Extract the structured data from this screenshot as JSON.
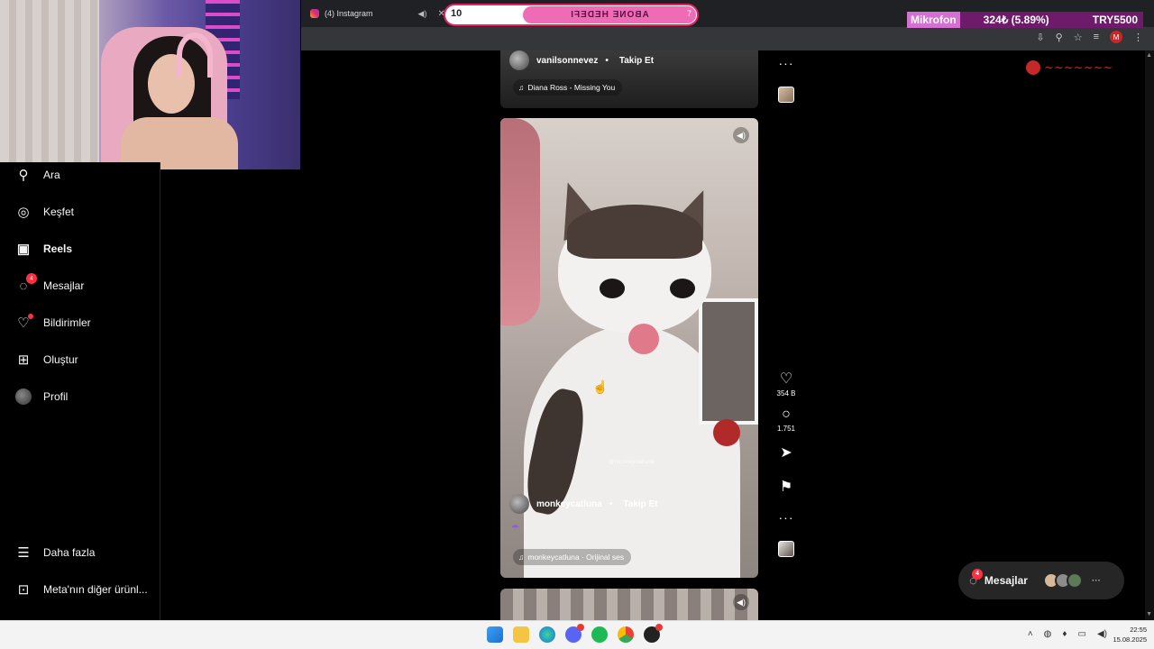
{
  "browser": {
    "tab_title": "(4) Instagram",
    "overlay_counter": "10",
    "overlay_banner": "ABONE HEDEFI",
    "overlay_banner_num": "7",
    "mic_label": "Mikrofon",
    "mic_amount": "324₺ (5.89%)",
    "mic_target": "TRY5500"
  },
  "nav": {
    "items": [
      {
        "label": "Ara",
        "icon": "search-icon"
      },
      {
        "label": "Keşfet",
        "icon": "compass-icon"
      },
      {
        "label": "Reels",
        "icon": "reels-icon"
      },
      {
        "label": "Mesajlar",
        "icon": "messenger-icon",
        "badge": "4"
      },
      {
        "label": "Bildirimler",
        "icon": "heart-icon"
      },
      {
        "label": "Oluştur",
        "icon": "plus-square-icon"
      },
      {
        "label": "Profil",
        "icon": "avatar"
      },
      {
        "label": "Daha fazla",
        "icon": "menu-icon"
      },
      {
        "label": "Meta'nın diğer ürünl...",
        "icon": "apps-icon"
      }
    ]
  },
  "reels": {
    "top": {
      "username": "vanilsonnevez",
      "follow": "Takip Et",
      "audio": "Diana Ross - Missing You"
    },
    "main": {
      "username": "monkeycatluna",
      "follow": "Takip Et",
      "audio": "monkeycatluna · Orijinal ses",
      "watermark": "@monkeycatluna",
      "likes": "354 B",
      "comments": "1.751"
    }
  },
  "messages_pill": {
    "label": "Mesajlar",
    "badge": "4"
  },
  "taskbar": {
    "time": "22:55",
    "date": "15.08.2025"
  },
  "colors": {
    "accent": "#ff3040",
    "mic_bar": "#6e1b6b",
    "overlay_pink": "#f06bb6"
  }
}
